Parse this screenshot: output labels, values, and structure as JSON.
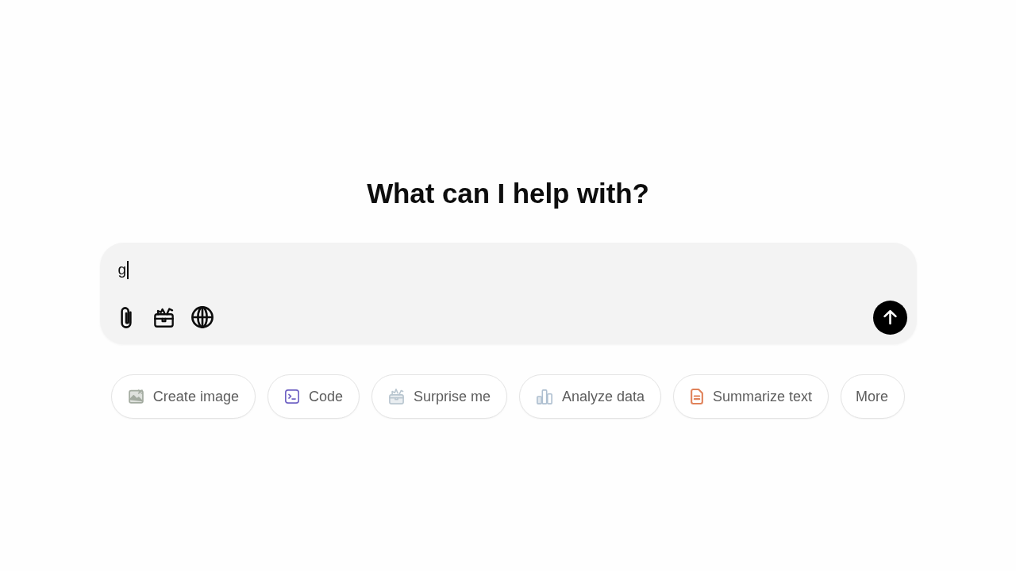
{
  "heading": "What can I help with?",
  "composer": {
    "value": "g",
    "cursor": true,
    "send_enabled": true
  },
  "chips": [
    {
      "label": "Create image",
      "kind": "image",
      "color": "#a3aba0"
    },
    {
      "label": "Code",
      "kind": "code",
      "color": "#6f62c4"
    },
    {
      "label": "Surprise me",
      "kind": "gift",
      "color": "#b9c6d0"
    },
    {
      "label": "Analyze data",
      "kind": "chart",
      "color": "#aebfd0"
    },
    {
      "label": "Summarize text",
      "kind": "document",
      "color": "#e0825a"
    },
    {
      "label": "More",
      "kind": "plain"
    }
  ]
}
